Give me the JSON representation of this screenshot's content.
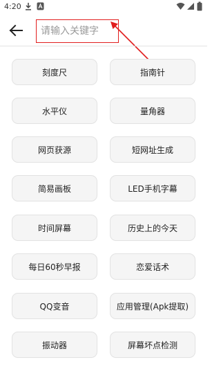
{
  "status_bar": {
    "time": "4:20",
    "icons": [
      "download-icon",
      "notification-a-icon",
      "wifi-icon",
      "signal-icon",
      "battery-icon"
    ]
  },
  "search": {
    "placeholder": "请输入关键字",
    "value": ""
  },
  "colors": {
    "annotation": "#e11d1d",
    "tile_background": "#f5f5f5",
    "tile_border": "#e2e2e2"
  },
  "tools": [
    {
      "label": "刻度尺"
    },
    {
      "label": "指南针"
    },
    {
      "label": "水平仪"
    },
    {
      "label": "量角器"
    },
    {
      "label": "网页获源"
    },
    {
      "label": "短网址生成"
    },
    {
      "label": "简易画板"
    },
    {
      "label": "LED手机字幕"
    },
    {
      "label": "时间屏幕"
    },
    {
      "label": "历史上的今天"
    },
    {
      "label": "每日60秒早报"
    },
    {
      "label": "恋爱话术"
    },
    {
      "label": "QQ变音"
    },
    {
      "label": "应用管理(Apk提取)"
    },
    {
      "label": "振动器"
    },
    {
      "label": "屏幕坏点检测"
    }
  ]
}
